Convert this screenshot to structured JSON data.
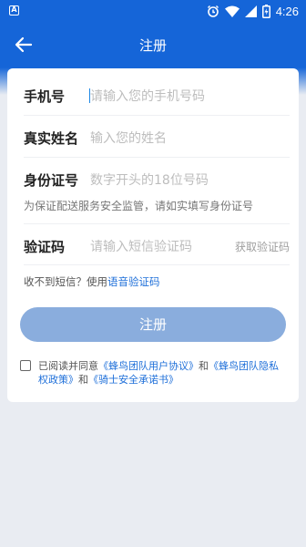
{
  "status_bar": {
    "time": "4:26",
    "left_icon": "a-box-icon",
    "icons": [
      "alarm-icon",
      "wifi-icon",
      "signal-icon",
      "battery-icon"
    ]
  },
  "header": {
    "title": "注册",
    "back_icon": "back-arrow-icon"
  },
  "form": {
    "phone": {
      "label": "手机号",
      "placeholder": "请输入您的手机号码"
    },
    "name": {
      "label": "真实姓名",
      "placeholder": "输入您的姓名"
    },
    "id_card": {
      "label": "身份证号",
      "placeholder": "数字开头的18位号码",
      "hint": "为保证配送服务安全监管，请如实填写身份证号"
    },
    "code": {
      "label": "验证码",
      "placeholder": "请输入短信验证码",
      "get_code": "获取验证码"
    }
  },
  "voice": {
    "prefix": "收不到短信？使用",
    "link": "语音验证码"
  },
  "register_button": "注册",
  "agreement": {
    "prefix": "已阅读并同意",
    "link1": "《蜂鸟团队用户协议》",
    "and1": "和",
    "link2": "《蜂鸟团队隐私权政策》",
    "and2": "和",
    "link3": "《骑士安全承诺书》"
  },
  "colors": {
    "primary": "#1565d8",
    "button_disabled": "#8aaddd",
    "link": "#1e6fd9",
    "background": "#e9ecf2"
  }
}
